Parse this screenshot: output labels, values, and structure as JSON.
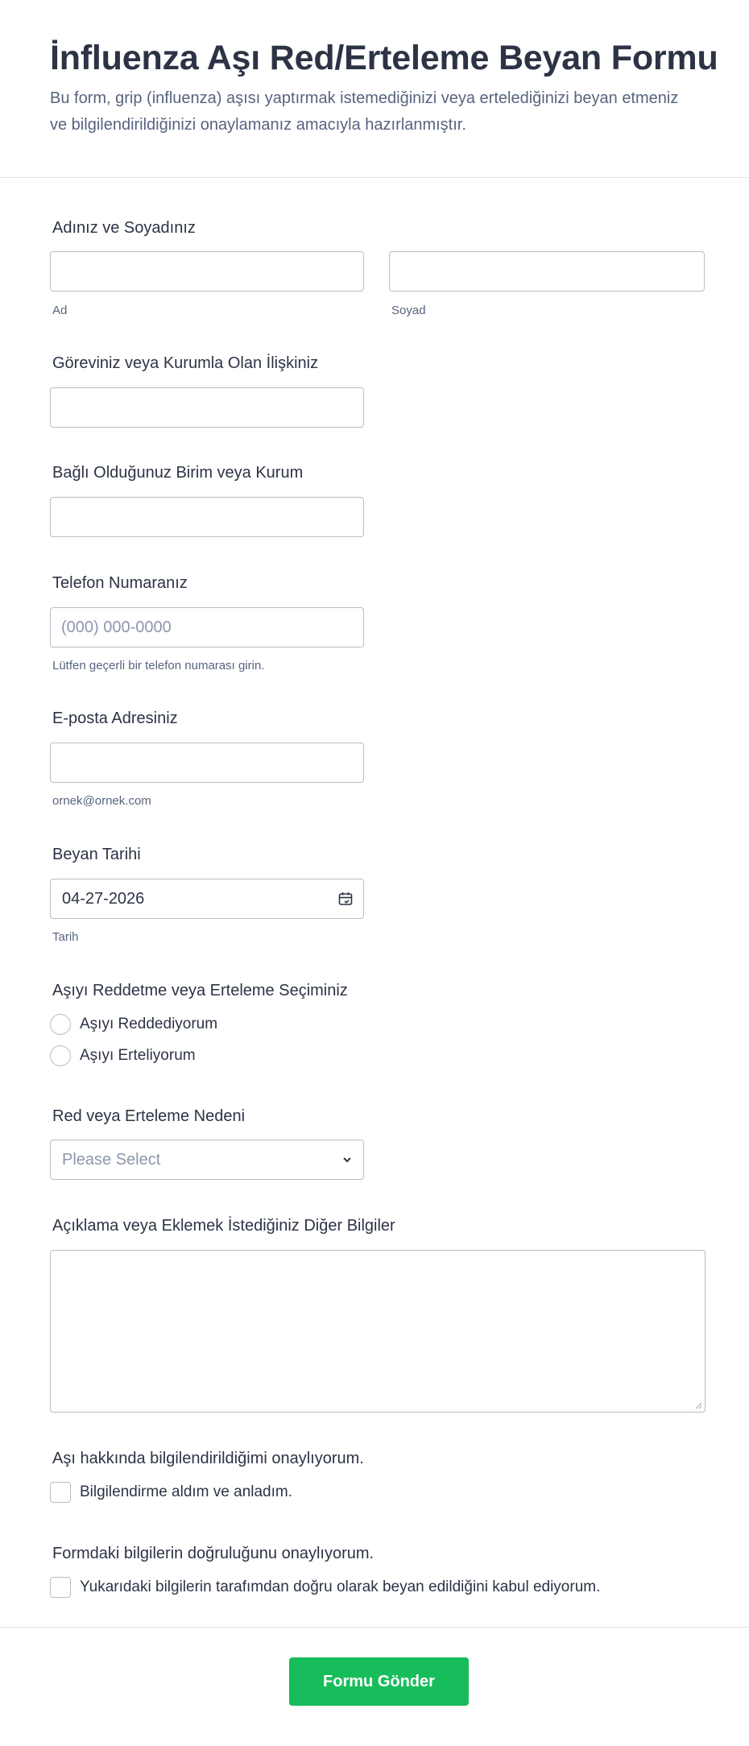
{
  "header": {
    "title": "İnfluenza Aşı Red/Erteleme Beyan Formu",
    "subtitle": "Bu form, grip (influenza) aşısı yaptırmak istemediğinizi veya ertelediğinizi beyan etmeniz ve bilgilendirildiğinizi onaylamanız amacıyla hazırlanmıştır."
  },
  "name": {
    "label": "Adınız ve Soyadınız",
    "first_value": "",
    "first_sublabel": "Ad",
    "last_value": "",
    "last_sublabel": "Soyad"
  },
  "position": {
    "label": "Göreviniz veya Kurumla Olan İlişkiniz",
    "value": ""
  },
  "unit": {
    "label": "Bağlı Olduğunuz Birim veya Kurum",
    "value": ""
  },
  "phone": {
    "label": "Telefon Numaranız",
    "placeholder": "(000) 000-0000",
    "sublabel": "Lütfen geçerli bir telefon numarası girin."
  },
  "email": {
    "label": "E-posta Adresiniz",
    "value": "",
    "sublabel": "ornek@ornek.com"
  },
  "date": {
    "label": "Beyan Tarihi",
    "value": "04-27-2026",
    "sublabel": "Tarih",
    "icon": "calendar-icon"
  },
  "choice": {
    "label": "Aşıyı Reddetme veya Erteleme Seçiminiz",
    "options": [
      "Aşıyı Reddediyorum",
      "Aşıyı Erteliyorum"
    ]
  },
  "reason": {
    "label": "Red veya Erteleme Nedeni",
    "selected": "Please Select",
    "icon": "chevron-down-icon"
  },
  "notes": {
    "label": "Açıklama veya Eklemek İstediğiniz Diğer Bilgiler",
    "value": ""
  },
  "consent_info": {
    "label": "Aşı hakkında bilgilendirildiğimi onaylıyorum.",
    "option": "Bilgilendirme aldım ve anladım."
  },
  "consent_accuracy": {
    "label": "Formdaki bilgilerin doğruluğunu onaylıyorum.",
    "option": "Yukarıdaki bilgilerin tarafımdan doğru olarak beyan edildiğini kabul ediyorum."
  },
  "submit": {
    "label": "Formu Gönder"
  },
  "colors": {
    "accent": "#18bd5b",
    "text": "#2c3345",
    "muted": "#57647e",
    "border": "#b8bdc9"
  }
}
